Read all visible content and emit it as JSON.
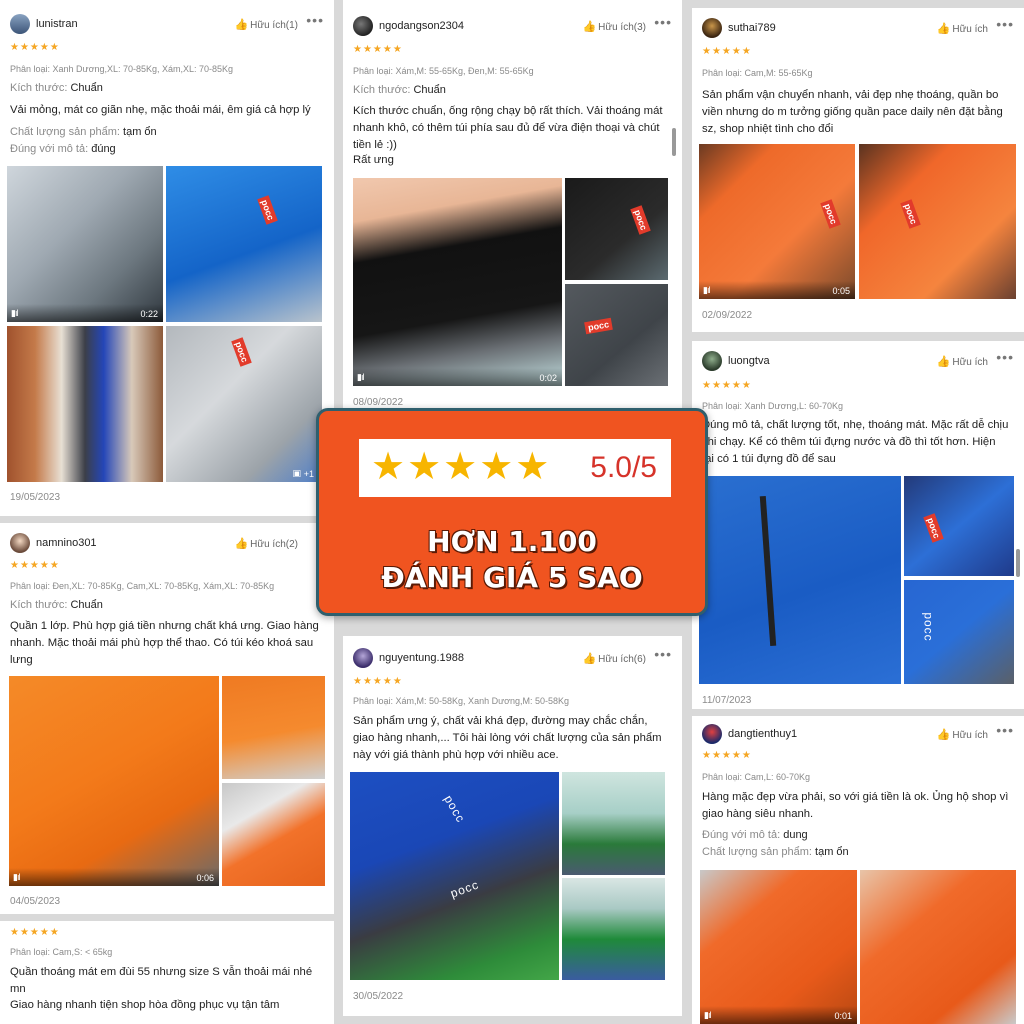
{
  "c1": {
    "user": "lunistran",
    "helpful": "Hữu ích(1)",
    "stars": "★★★★★",
    "classification": "Phân loại: Xanh Dương,XL: 70-85Kg, Xám,XL: 70-85Kg",
    "size_label": "Kích thước:",
    "size_value": "Chuẩn",
    "text": "Vải mỏng, mát co giãn nhẹ, mặc thoải mái, êm giá cả hợp lý",
    "quality_label": "Chất lượng sản phẩm:",
    "quality_value": "tạm ổn",
    "desc_label": "Đúng với mô tả:",
    "desc_value": "đúng",
    "video_duration": "0:22",
    "more_images": "+1",
    "date": "19/05/2023"
  },
  "c2": {
    "user": "ngodangson2304",
    "helpful": "Hữu ích(3)",
    "stars": "★★★★★",
    "classification": "Phân loại: Xám,M: 55-65Kg, Đen,M: 55-65Kg",
    "size_label": "Kích thước:",
    "size_value": "Chuẩn",
    "text": "Kích thước chuẩn, ống rộng chạy bộ rất thích. Vải thoáng mát nhanh khô, có thêm túi phía sau đủ để vừa điện thoại và chút tiền lẻ :))",
    "text2": "Rất ưng",
    "video_duration": "0:02",
    "date": "08/09/2022"
  },
  "c3": {
    "user": "suthai789",
    "helpful": "Hữu ích",
    "stars": "★★★★★",
    "classification": "Phân loại: Cam,M: 55-65Kg",
    "text": "Sản phẩm vận chuyển nhanh, vải đẹp nhẹ thoáng, quần bo viền nhưng do m tưởng giống quần pace daily nên đặt bằng sz, shop nhiệt tình cho đổi",
    "video_duration": "0:05",
    "date": "02/09/2022"
  },
  "c4": {
    "user": "luongtva",
    "helpful": "Hữu ích",
    "stars": "★★★★★",
    "classification": "Phân loại: Xanh Dương,L: 60-70Kg",
    "text": "Đúng mô tả, chất lượng tốt, nhẹ, thoáng mát. Mặc rất dễ chịu khi chạy. Kể có thêm túi đựng nước và đồ thì tốt hơn. Hiện tại có 1 túi đựng đồ để sau",
    "date": "11/07/2023"
  },
  "c5": {
    "user": "namnino301",
    "helpful": "Hữu ích(2)",
    "stars": "★★★★★",
    "classification": "Phân loại: Đen,XL: 70-85Kg, Cam,XL: 70-85Kg, Xám,XL: 70-85Kg",
    "size_label": "Kích thước:",
    "size_value": "Chuẩn",
    "text": "Quần 1 lớp. Phù hợp giá tiền nhưng chất khá ưng. Giao hàng nhanh. Mặc thoải mái phù hợp thể thao. Có túi kéo khoá sau lưng",
    "video_duration": "0:06",
    "date": "04/05/2023"
  },
  "c6": {
    "stars": "★★★★★",
    "classification": "Phân loại: Cam,S: < 65kg",
    "text": "Quần thoáng mát em đùi 55 nhưng size S vẫn thoải mái nhé mn",
    "text2": "Giao hàng nhanh tiện shop hòa đồng phục vụ tận tâm"
  },
  "c7": {
    "user": "nguyentung.1988",
    "helpful": "Hữu ích(6)",
    "stars": "★★★★★",
    "classification": "Phân loại: Xám,M: 50-58Kg, Xanh Dương,M: 50-58Kg",
    "text": "Sản phẩm ưng ý, chất vải khá đẹp, đường may chắc chắn, giao hàng nhanh,... Tôi hài lòng với chất lượng của sản phẩm này với giá thành phù hợp với nhiều ace.",
    "date": "30/05/2022"
  },
  "c8": {
    "user": "dangtienthuy1",
    "helpful": "Hữu ích",
    "stars": "★★★★★",
    "classification": "Phân loại: Cam,L: 60-70Kg",
    "text": "Hàng mặc đẹp vừa phải, so với giá tiền là ok. Ủng hộ shop vì giao hàng siêu nhanh.",
    "desc_label": "Đúng với mô tả:",
    "desc_value": "dung",
    "quality_label": "Chất lượng sản phẩm:",
    "quality_value": "tạm ổn",
    "video_duration": "0:01"
  },
  "banner": {
    "stars": "★★★★★",
    "score": "5.0/5",
    "line1": "HƠN 1.100",
    "line2": "ĐÁNH GIÁ 5 SAO"
  },
  "photo_brand": "pocc",
  "colors": {
    "accent": "#f05420",
    "star": "#f5a623",
    "banner_border": "#2f5f6d",
    "score": "#d6332a"
  }
}
